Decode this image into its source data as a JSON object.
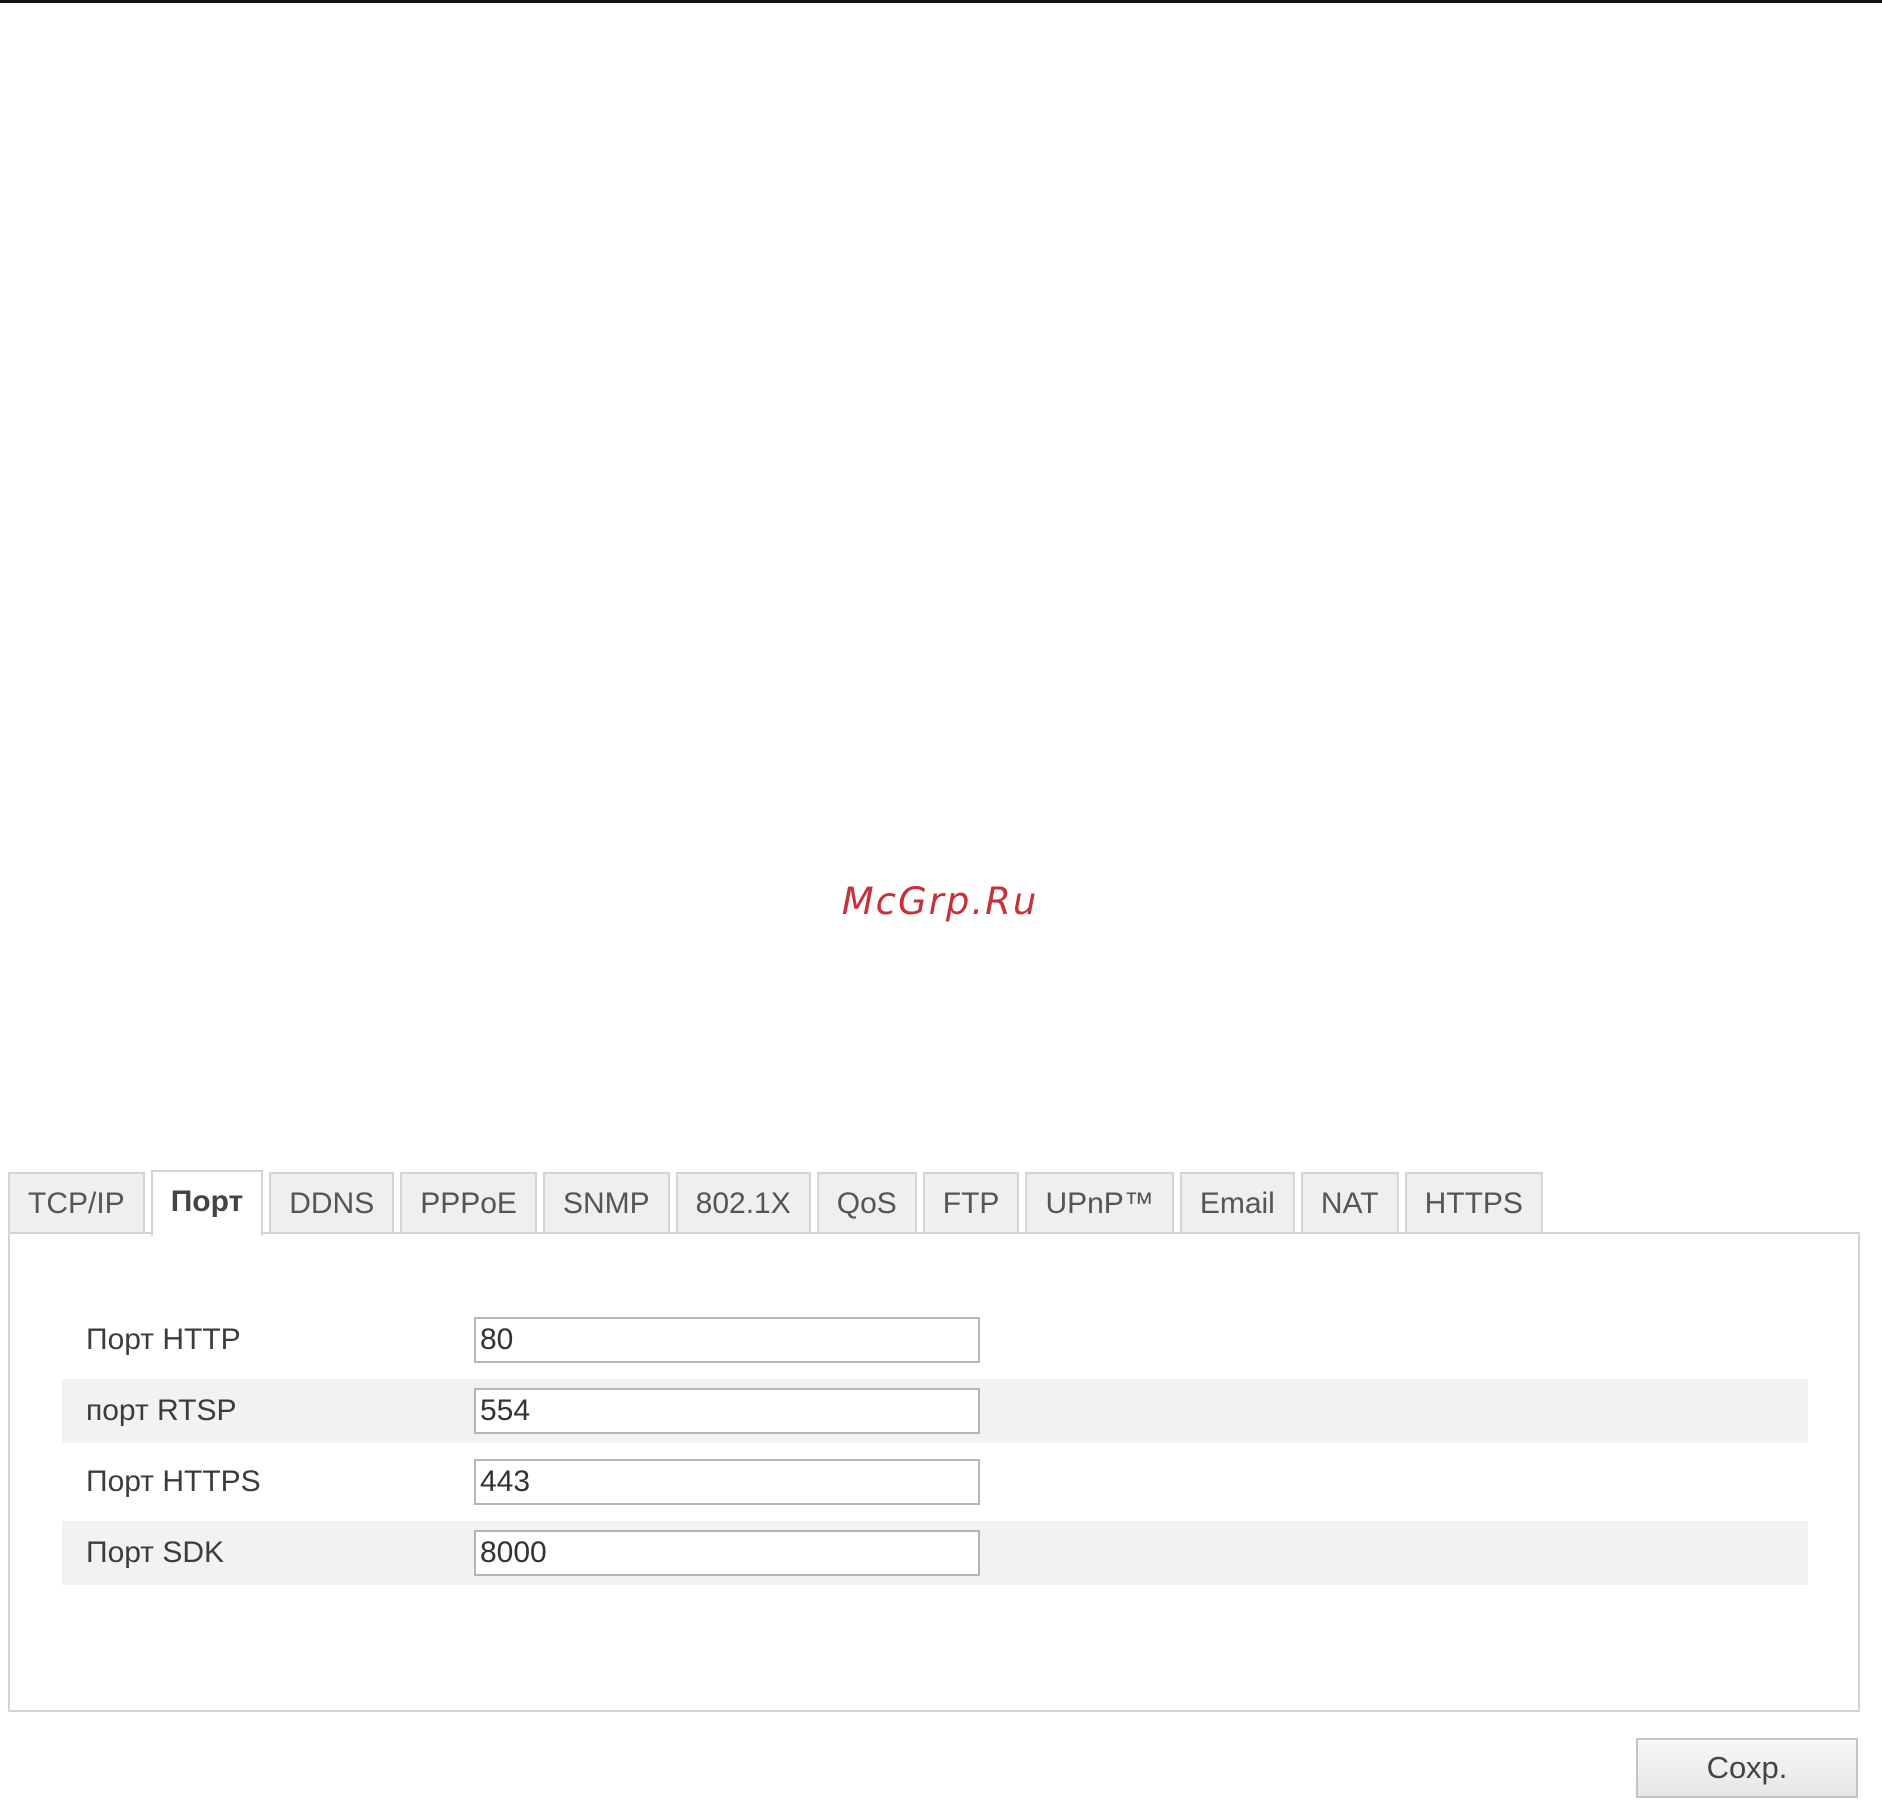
{
  "watermark": "McGrp.Ru",
  "tabs": [
    {
      "label": "TCP/IP",
      "active": false
    },
    {
      "label": "Порт",
      "active": true
    },
    {
      "label": "DDNS",
      "active": false
    },
    {
      "label": "PPPoE",
      "active": false
    },
    {
      "label": "SNMP",
      "active": false
    },
    {
      "label": "802.1X",
      "active": false
    },
    {
      "label": "QoS",
      "active": false
    },
    {
      "label": "FTP",
      "active": false
    },
    {
      "label": "UPnP™",
      "active": false
    },
    {
      "label": "Email",
      "active": false
    },
    {
      "label": "NAT",
      "active": false
    },
    {
      "label": "HTTPS",
      "active": false
    }
  ],
  "ports": [
    {
      "label": "Порт HTTP",
      "value": "80"
    },
    {
      "label": "порт RTSP",
      "value": "554"
    },
    {
      "label": "Порт HTTPS",
      "value": "443"
    },
    {
      "label": "Порт SDK",
      "value": "8000"
    }
  ],
  "save_label": "Сохр."
}
